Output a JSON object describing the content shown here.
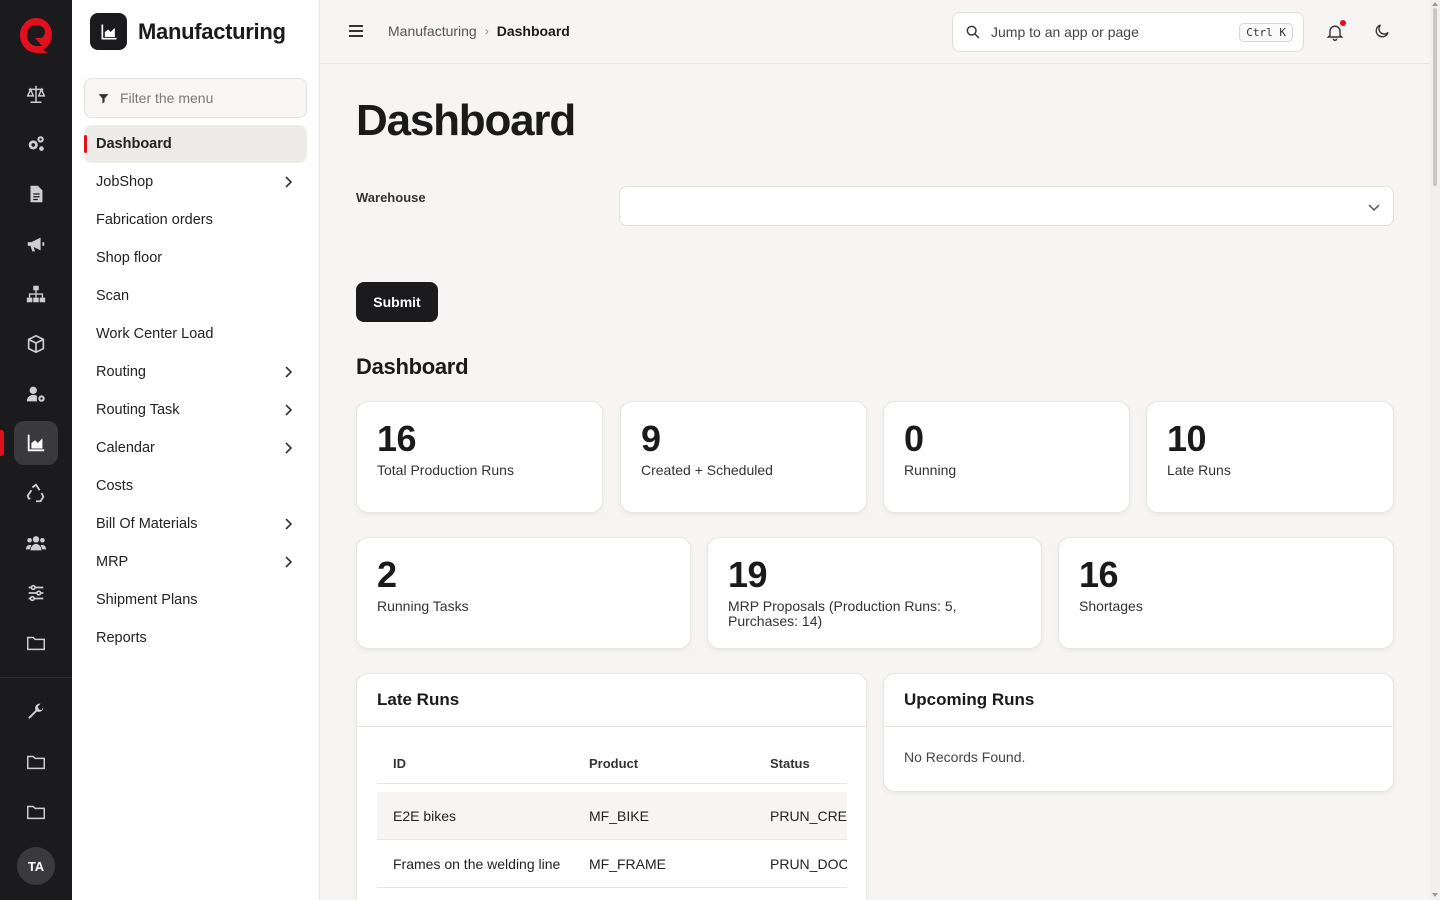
{
  "app": {
    "title": "Manufacturing"
  },
  "user": {
    "initials": "TA"
  },
  "rail": {
    "icons": [
      "balance-scale-icon",
      "gears-icon",
      "document-icon",
      "megaphone-icon",
      "sitemap-icon",
      "cube-icon",
      "user-settings-icon",
      "factory-chart-icon",
      "recycle-icon",
      "users-icon",
      "sliders-icon",
      "folder-icon",
      "wrench-icon",
      "folder-icon",
      "folder-icon"
    ],
    "active": "factory-chart-icon"
  },
  "sidebar": {
    "filter_placeholder": "Filter the menu",
    "items": [
      {
        "label": "Dashboard",
        "active": true,
        "chevron": false
      },
      {
        "label": "JobShop",
        "chevron": true
      },
      {
        "label": "Fabrication orders",
        "chevron": false
      },
      {
        "label": "Shop floor",
        "chevron": false
      },
      {
        "label": "Scan",
        "chevron": false
      },
      {
        "label": "Work Center Load",
        "chevron": false
      },
      {
        "label": "Routing",
        "chevron": true
      },
      {
        "label": "Routing Task",
        "chevron": true
      },
      {
        "label": "Calendar",
        "chevron": true
      },
      {
        "label": "Costs",
        "chevron": false
      },
      {
        "label": "Bill Of Materials",
        "chevron": true
      },
      {
        "label": "MRP",
        "chevron": true
      },
      {
        "label": "Shipment Plans",
        "chevron": false
      },
      {
        "label": "Reports",
        "chevron": false
      }
    ]
  },
  "topbar": {
    "breadcrumb": [
      "Manufacturing",
      "Dashboard"
    ],
    "search_placeholder": "Jump to an app or page",
    "search_shortcut": "Ctrl K"
  },
  "main": {
    "title": "Dashboard",
    "warehouse_label": "Warehouse",
    "warehouse_value": "",
    "submit_label": "Submit",
    "section_title": "Dashboard",
    "stats_row1": [
      {
        "value": "16",
        "label": "Total Production Runs"
      },
      {
        "value": "9",
        "label": "Created + Scheduled"
      },
      {
        "value": "0",
        "label": "Running"
      },
      {
        "value": "10",
        "label": "Late Runs"
      }
    ],
    "stats_row2": [
      {
        "value": "2",
        "label": "Running Tasks"
      },
      {
        "value": "19",
        "label": "MRP Proposals (Production Runs: 5, Purchases: 14)"
      },
      {
        "value": "16",
        "label": "Shortages"
      }
    ],
    "late_runs": {
      "title": "Late Runs",
      "columns": [
        "ID",
        "Product",
        "Status"
      ],
      "rows": [
        [
          "E2E bikes",
          "MF_BIKE",
          "PRUN_CREATED"
        ],
        [
          "Frames on the welding line",
          "MF_FRAME",
          "PRUN_DOC_PRINTED"
        ]
      ]
    },
    "upcoming_runs": {
      "title": "Upcoming Runs",
      "empty_text": "No Records Found."
    }
  },
  "colors": {
    "accent": "#e0101e",
    "rail_bg": "#1b1b1d",
    "page_bg": "#f6f5f3"
  }
}
